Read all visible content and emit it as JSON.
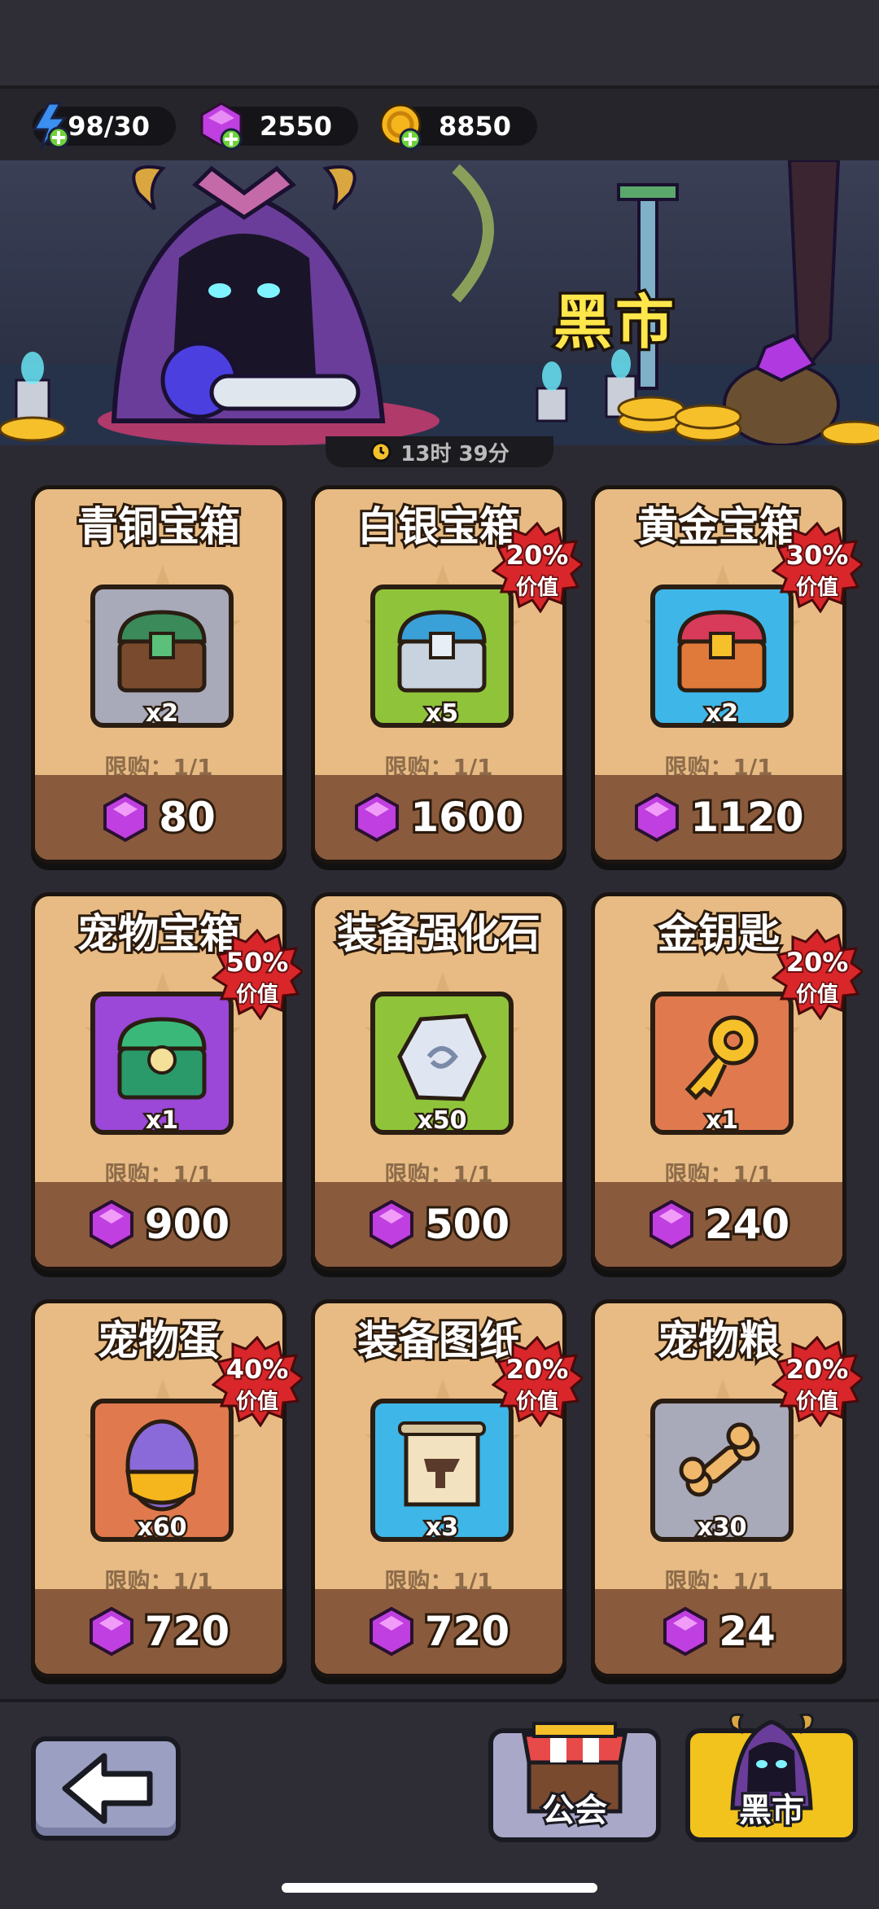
{
  "resources": {
    "energy": "98/30",
    "gems": "2550",
    "coins": "8850"
  },
  "banner": {
    "title": "黑市",
    "timer": "13时 39分"
  },
  "items": [
    {
      "title": "青铜宝箱",
      "qty": "x2",
      "limit": "限购：1/1",
      "price": "80",
      "badge": null,
      "frame": "#a8a9b9",
      "kind": "chest-bronze"
    },
    {
      "title": "白银宝箱",
      "qty": "x5",
      "limit": "限购：1/1",
      "price": "1600",
      "badge": {
        "pct": "20%",
        "text": "价值"
      },
      "frame": "#8fc43a",
      "kind": "chest-silver"
    },
    {
      "title": "黄金宝箱",
      "qty": "x2",
      "limit": "限购：1/1",
      "price": "1120",
      "badge": {
        "pct": "30%",
        "text": "价值"
      },
      "frame": "#3eb6e8",
      "kind": "chest-gold"
    },
    {
      "title": "宠物宝箱",
      "qty": "x1",
      "limit": "限购：1/1",
      "price": "900",
      "badge": {
        "pct": "50%",
        "text": "价值"
      },
      "frame": "#9b47d8",
      "kind": "chest-pet"
    },
    {
      "title": "装备强化石",
      "qty": "x50",
      "limit": "限购：1/1",
      "price": "500",
      "badge": null,
      "frame": "#8fc43a",
      "kind": "stone"
    },
    {
      "title": "金钥匙",
      "qty": "x1",
      "limit": "限购：1/1",
      "price": "240",
      "badge": {
        "pct": "20%",
        "text": "价值"
      },
      "frame": "#e07a4e",
      "kind": "key"
    },
    {
      "title": "宠物蛋",
      "qty": "x60",
      "limit": "限购：1/1",
      "price": "720",
      "badge": {
        "pct": "40%",
        "text": "价值"
      },
      "frame": "#e07a4e",
      "kind": "egg"
    },
    {
      "title": "装备图纸",
      "qty": "x3",
      "limit": "限购：1/1",
      "price": "720",
      "badge": {
        "pct": "20%",
        "text": "价值"
      },
      "frame": "#3eb6e8",
      "kind": "scroll"
    },
    {
      "title": "宠物粮",
      "qty": "x30",
      "limit": "限购：1/1",
      "price": "24",
      "badge": {
        "pct": "20%",
        "text": "价值"
      },
      "frame": "#a8a9b9",
      "kind": "bone"
    }
  ],
  "nav": {
    "guild": "公会",
    "black_market": "黑市"
  },
  "colors": {
    "gem": "#c03fe0",
    "coin": "#f5b51c",
    "energy": "#3a8ff0",
    "badge": "#d9262a",
    "active_tab": "#f2c21d",
    "guild_tab": "#a9a8c9"
  }
}
